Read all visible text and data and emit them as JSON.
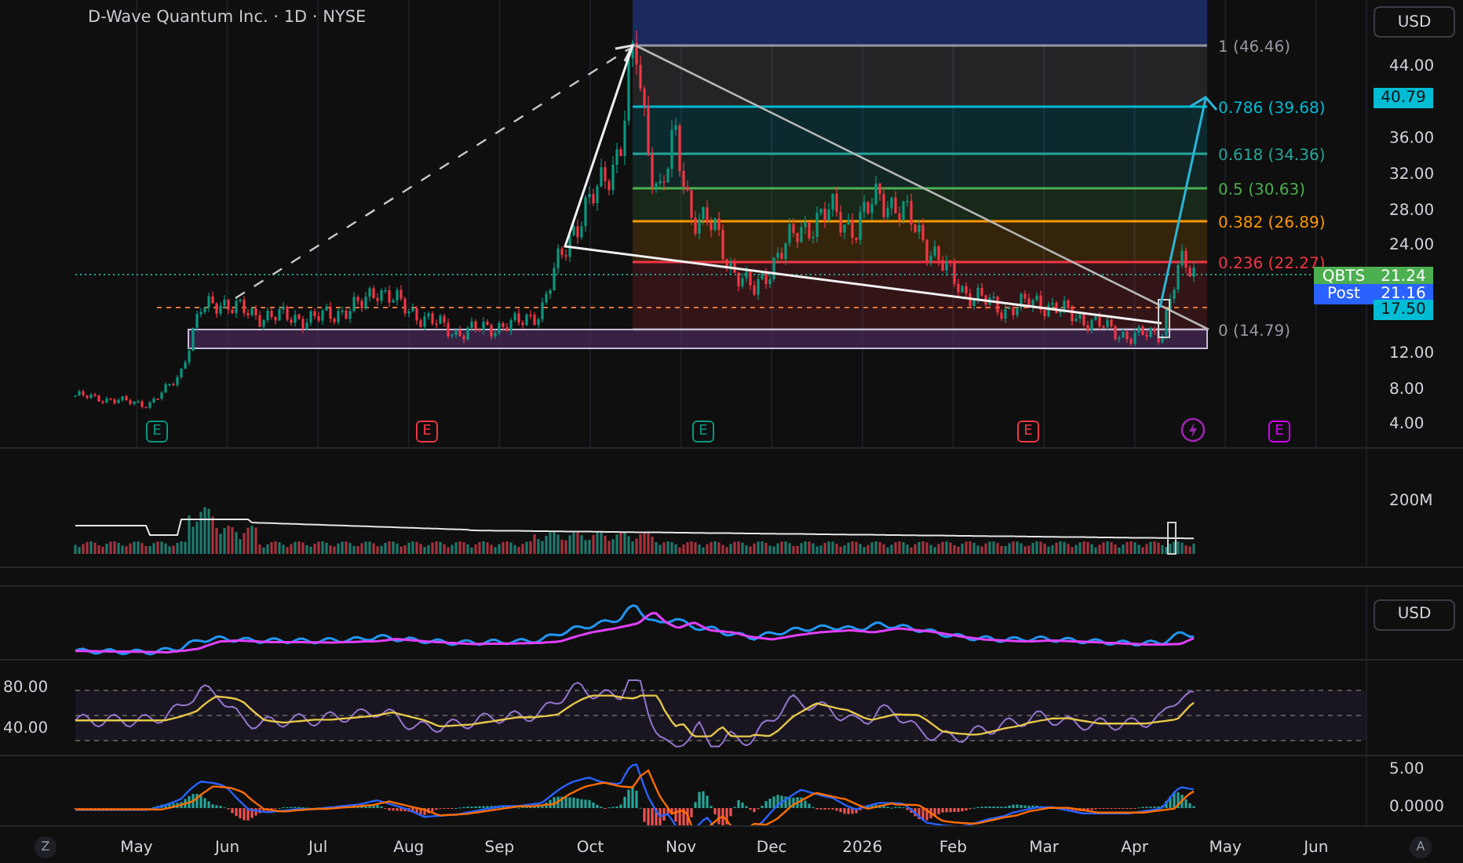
{
  "header": {
    "title": "D-Wave Quantum Inc. · 1D · NYSE",
    "currency_button": "USD"
  },
  "price_axis": {
    "ticks": [
      "44.00",
      "36.00",
      "32.00",
      "28.00",
      "24.00",
      "12.00",
      "8.00",
      "4.00"
    ]
  },
  "price_tags": [
    {
      "kind": "plain",
      "value": "40.79",
      "color": "#00bcd4"
    },
    {
      "kind": "symbol",
      "label": "QBTS",
      "value": "21.24",
      "color": "#4caf50"
    },
    {
      "kind": "symbol",
      "label": "Post",
      "value": "21.16",
      "color": "#2962ff"
    },
    {
      "kind": "plain",
      "value": "17.50",
      "color": "#00bcd4"
    }
  ],
  "fib_levels": [
    {
      "label": "1 (46.46)",
      "color": "#9598a1"
    },
    {
      "label": "0.786 (39.68)",
      "color": "#00bcd4"
    },
    {
      "label": "0.618 (34.36)",
      "color": "#26a69a"
    },
    {
      "label": "0.5 (30.63)",
      "color": "#4caf50"
    },
    {
      "label": "0.382 (26.89)",
      "color": "#ff9800"
    },
    {
      "label": "0.236 (22.27)",
      "color": "#f23645"
    },
    {
      "label": "0 (14.79)",
      "color": "#9598a1"
    }
  ],
  "event_markers": [
    {
      "kind": "earnings",
      "label": "E",
      "color": "#089981"
    },
    {
      "kind": "earnings",
      "label": "E",
      "color": "#f23645"
    },
    {
      "kind": "earnings",
      "label": "E",
      "color": "#089981"
    },
    {
      "kind": "earnings",
      "label": "E",
      "color": "#f23645"
    },
    {
      "kind": "event",
      "color": "#9c27b0"
    },
    {
      "kind": "earnings",
      "label": "E",
      "color": "#d500f9"
    }
  ],
  "volume": {
    "axis_label": "200M"
  },
  "indicator": {
    "currency_button": "USD"
  },
  "rsi": {
    "ticks": [
      "80.00",
      "40.00"
    ]
  },
  "macd": {
    "ticks": [
      "5.00",
      "0.0000"
    ]
  },
  "time_axis": {
    "labels": [
      "May",
      "Jun",
      "Jul",
      "Aug",
      "Sep",
      "Oct",
      "Nov",
      "Dec",
      "2026",
      "Feb",
      "Mar",
      "Apr",
      "May",
      "Jun"
    ]
  },
  "corner_buttons": [
    "Z",
    "A"
  ]
}
